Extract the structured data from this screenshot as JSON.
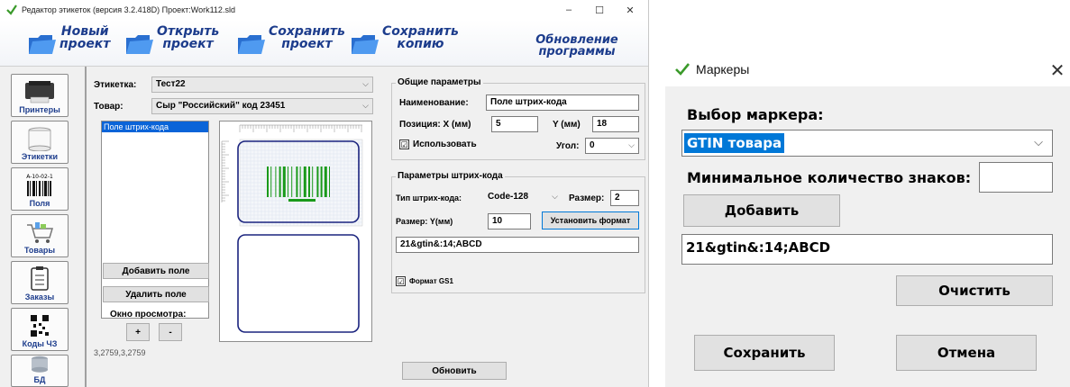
{
  "main_window": {
    "title": "Редактор этикеток (версия 3.2.418D) Проект:Work112.sld",
    "window_controls": {
      "minimize": "–",
      "maximize": "☐",
      "close": "✕"
    },
    "toolbar": {
      "new_project": {
        "line1": "Новый",
        "line2": "проект"
      },
      "open_project": {
        "line1": "Открыть",
        "line2": "проект"
      },
      "save_project": {
        "line1": "Сохранить",
        "line2": "проект"
      },
      "save_copy": {
        "line1": "Сохранить",
        "line2": "копию"
      },
      "update": {
        "line1": "Обновление",
        "line2": "программы"
      }
    },
    "sidebar": [
      {
        "label": "Принтеры",
        "icon": "printer-icon"
      },
      {
        "label": "Этикетки",
        "icon": "label-roll-icon"
      },
      {
        "label": "Поля",
        "icon": "barcode-fields-icon"
      },
      {
        "label": "Товары",
        "icon": "cart-icon"
      },
      {
        "label": "Заказы",
        "icon": "clipboard-icon"
      },
      {
        "label": "Коды ЧЗ",
        "icon": "qr-code-icon"
      },
      {
        "label": "БД",
        "icon": "database-icon"
      }
    ],
    "label_select": {
      "label": "Этикетка:",
      "value": "Тест22"
    },
    "product_select": {
      "label": "Товар:",
      "value": "Сыр \"Российский\" код 23451"
    },
    "fields_list": [
      "Поле штрих-кода"
    ],
    "add_field_button": "Добавить поле",
    "remove_field_button": "Удалить поле",
    "preview_window_label": "Окно просмотра:",
    "zoom_in": "+",
    "zoom_out": "-",
    "coordinates": "3,2759,3,2759",
    "general_params": {
      "title": "Общие параметры",
      "name_label": "Наименование:",
      "name_value": "Поле штрих-кода",
      "pos_x_label": "Позиция:  X (мм)",
      "pos_x_value": "5",
      "pos_y_label": "Y (мм)",
      "pos_y_value": "18",
      "use_label": "Использовать",
      "use_checked": "☑",
      "angle_label": "Угол:",
      "angle_value": "0"
    },
    "barcode_params": {
      "title": "Параметры штрих-кода",
      "type_label": "Тип штрих-кода:",
      "type_value": "Code-128",
      "size_label": "Размер:",
      "size_value": "2",
      "size_y_label": "Размер: Y(мм)",
      "size_y_value": "10",
      "set_format_button": "Установить формат",
      "format_value": "21&gtin&:14;ABCD",
      "gs1_label": "Формат GS1",
      "gs1_checked": "☑"
    },
    "refresh_button": "Обновить"
  },
  "markers_dialog": {
    "title": "Маркеры",
    "close": "✕",
    "select_marker_label": "Выбор маркера:",
    "marker_value": "GTIN товара",
    "min_chars_label": "Минимальное количество знаков:",
    "min_chars_value": "",
    "add_button": "Добавить",
    "format_value": "21&gtin&:14;ABCD",
    "clear_button": "Очистить",
    "save_button": "Сохранить",
    "cancel_button": "Отмена"
  },
  "colors": {
    "toolbar_text": "#1c3c8c",
    "selection": "#0078d7",
    "preview_border": "#1a237e",
    "barcode_bars": "#1a9a1a"
  }
}
